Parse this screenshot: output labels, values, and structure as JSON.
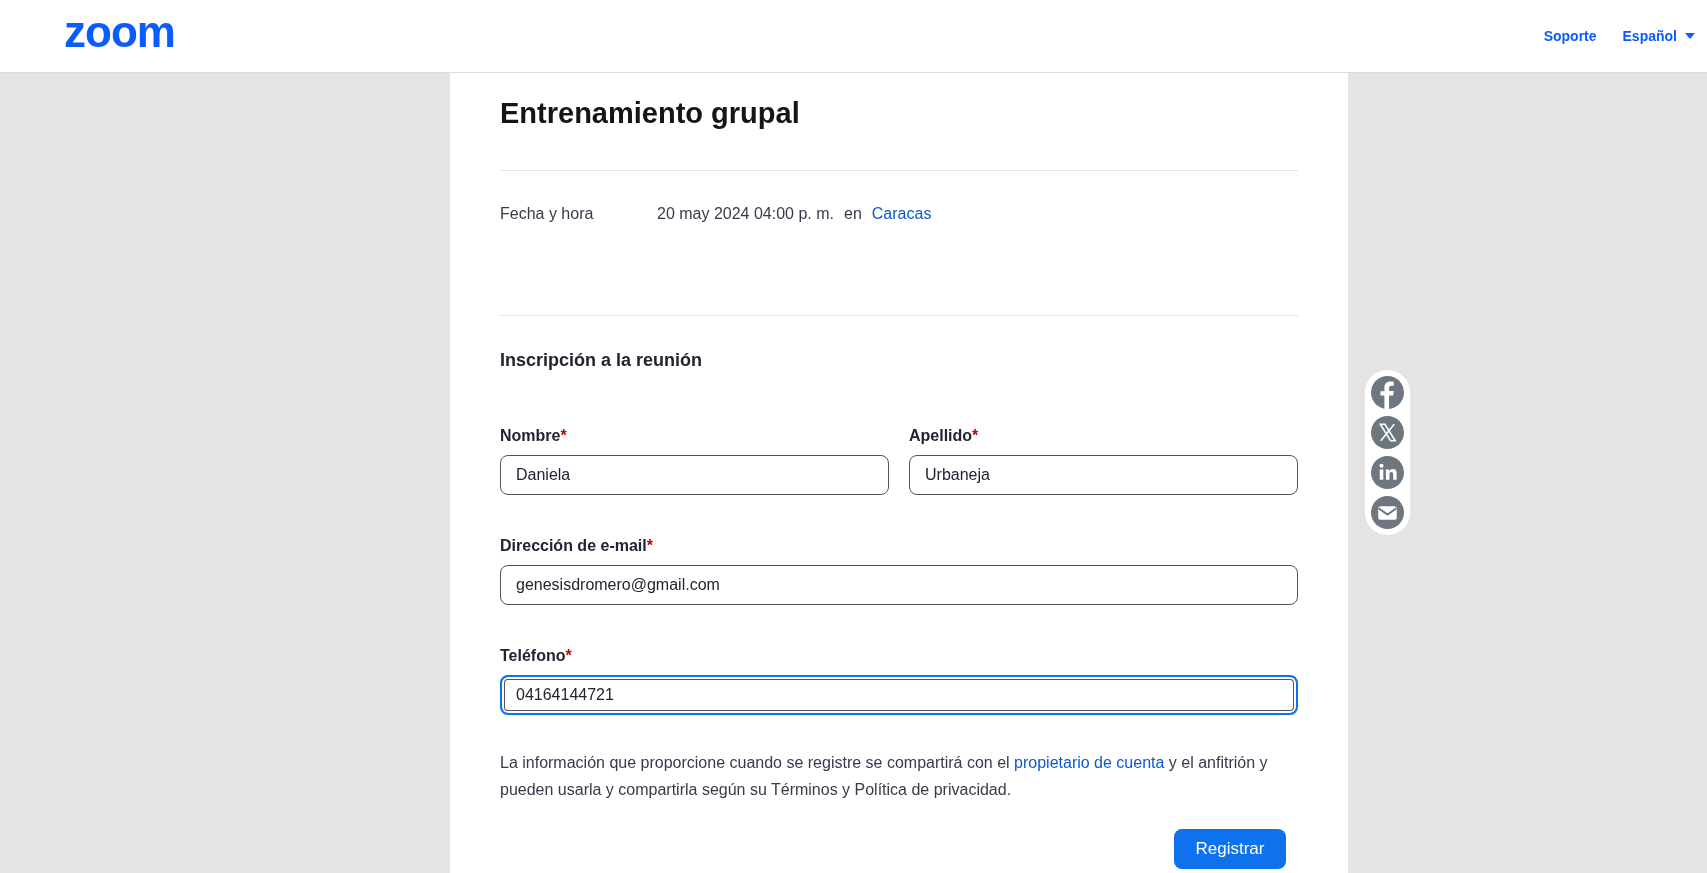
{
  "header": {
    "logo": "zoom",
    "links": [
      {
        "label": "Soporte",
        "dropdown": false
      },
      {
        "label": "Español",
        "dropdown": true
      }
    ]
  },
  "meeting": {
    "title": "Entrenamiento grupal",
    "date_label": "Fecha y hora",
    "date_value": "20 may 2024 04:00 p. m.",
    "date_joiner": "en",
    "timezone_link": "Caracas"
  },
  "form": {
    "heading": "Inscripción a la reunión",
    "fields": [
      {
        "label": "Nombre",
        "mark": "*",
        "value": "Daniela",
        "focused": false
      },
      {
        "label": "Apellido",
        "mark": "*",
        "value": "Urbaneja",
        "focused": false
      },
      {
        "label": "Dirección de e-mail",
        "mark": "*",
        "value": "genesisdromero@gmail.com",
        "focused": false
      },
      {
        "label": "Teléfono",
        "mark": "*",
        "value": "04164144721",
        "focused": true
      }
    ],
    "notice_before": "La información que proporcione cuando se registre se compartirá con el",
    "notice_link": "propietario de cuenta",
    "notice_after": "y el anfitrión y pueden usarla y compartirla según su Términos y Política de privacidad.",
    "submit": "Registrar"
  },
  "share": [
    {
      "kind": "facebook"
    },
    {
      "kind": "x"
    },
    {
      "kind": "linkedin"
    },
    {
      "kind": "email"
    }
  ]
}
